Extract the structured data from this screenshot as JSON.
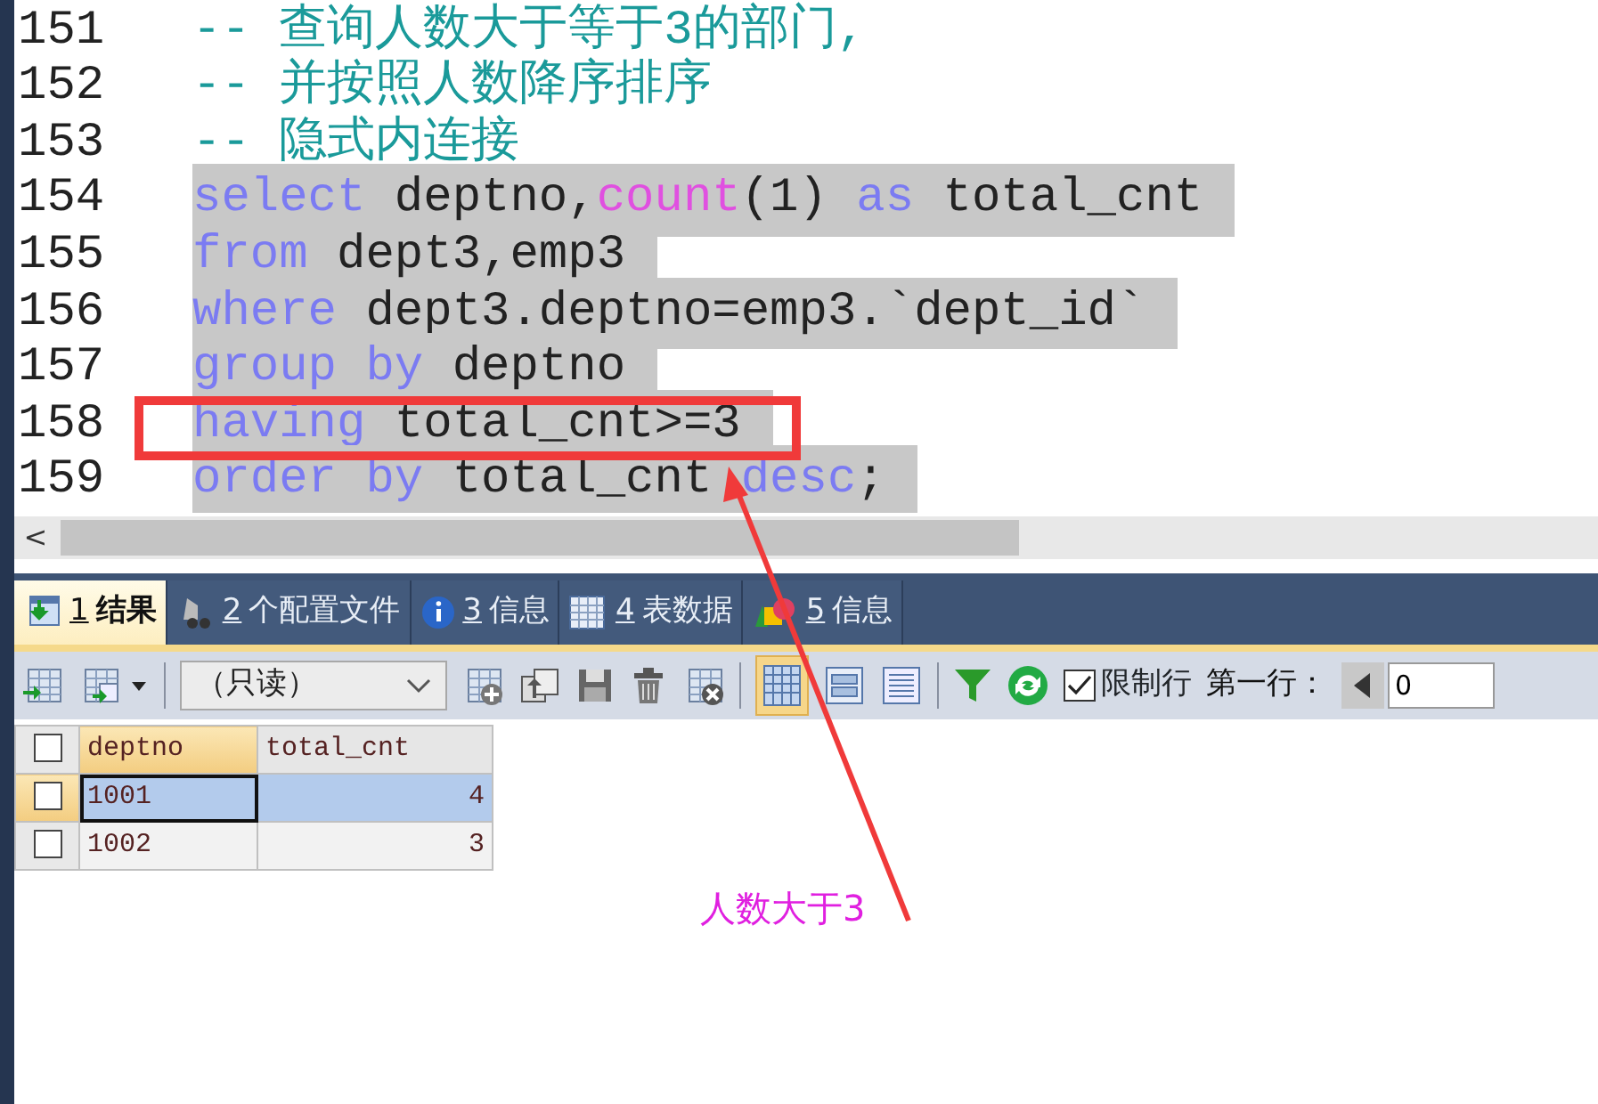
{
  "editor": {
    "lines": [
      {
        "number": "151",
        "selected": false,
        "tokens": [
          {
            "kind": "comment",
            "text": "-- 查询人数大于等于3的部门,"
          }
        ]
      },
      {
        "number": "152",
        "selected": false,
        "tokens": [
          {
            "kind": "comment",
            "text": "-- 并按照人数降序排序"
          }
        ]
      },
      {
        "number": "153",
        "selected": false,
        "tokens": [
          {
            "kind": "comment",
            "text": "-- 隐式内连接"
          }
        ]
      },
      {
        "number": "154",
        "selected": true,
        "tokens": [
          {
            "kind": "keyword",
            "text": "select"
          },
          {
            "kind": "plain",
            "text": " deptno,"
          },
          {
            "kind": "function",
            "text": "count"
          },
          {
            "kind": "plain",
            "text": "(1) "
          },
          {
            "kind": "keyword",
            "text": "as"
          },
          {
            "kind": "plain",
            "text": " total_cnt"
          }
        ]
      },
      {
        "number": "155",
        "selected": true,
        "tokens": [
          {
            "kind": "keyword",
            "text": "from"
          },
          {
            "kind": "plain",
            "text": " dept3,emp3"
          }
        ]
      },
      {
        "number": "156",
        "selected": true,
        "tokens": [
          {
            "kind": "keyword",
            "text": "where"
          },
          {
            "kind": "plain",
            "text": " dept3.deptno=emp3.`dept_id`"
          }
        ]
      },
      {
        "number": "157",
        "selected": true,
        "tokens": [
          {
            "kind": "keyword",
            "text": "group by"
          },
          {
            "kind": "plain",
            "text": " deptno"
          }
        ]
      },
      {
        "number": "158",
        "selected": true,
        "tokens": [
          {
            "kind": "keyword",
            "text": "having"
          },
          {
            "kind": "plain",
            "text": " total_cnt>=3"
          }
        ]
      },
      {
        "number": "159",
        "selected": true,
        "tokens": [
          {
            "kind": "keyword",
            "text": "order by"
          },
          {
            "kind": "plain",
            "text": " total_cnt "
          },
          {
            "kind": "keyword",
            "text": "desc"
          },
          {
            "kind": "plain",
            "text": ";"
          }
        ]
      }
    ],
    "scroll_left": "<"
  },
  "tabs": [
    {
      "number": "1",
      "label": "结果",
      "selected": true
    },
    {
      "number": "2",
      "label": "个配置文件",
      "selected": false
    },
    {
      "number": "3",
      "label": "信息",
      "selected": false
    },
    {
      "number": "4",
      "label": "表数据",
      "selected": false
    },
    {
      "number": "5",
      "label": "信息",
      "selected": false
    }
  ],
  "toolbar": {
    "mode_select": "（只读）",
    "limit_rows": {
      "label": "限制行",
      "checked": true
    },
    "first_row_label": "第一行：",
    "first_row_value": "0"
  },
  "grid": {
    "all_selected": false,
    "columns": [
      "deptno",
      "total_cnt"
    ],
    "rows": [
      {
        "cells": [
          "1001",
          "4"
        ],
        "selected": true
      },
      {
        "cells": [
          "1002",
          "3"
        ],
        "selected": false
      }
    ]
  },
  "annotation": {
    "text": "人数大于3"
  }
}
